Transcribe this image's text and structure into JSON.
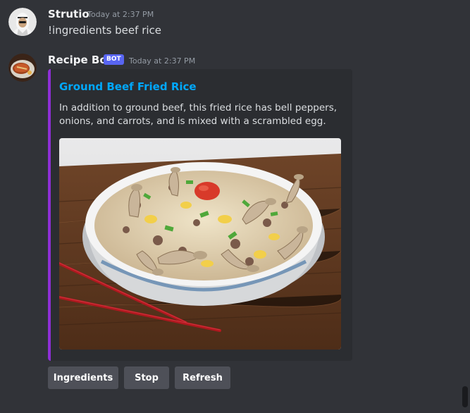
{
  "messages": [
    {
      "author": "Strutio",
      "timestamp": "Today at 2:37 PM",
      "text": "!ingredients beef rice"
    },
    {
      "author": "Recipe Bot",
      "badge": "BOT",
      "timestamp": "Today at 2:37 PM",
      "embed": {
        "title": "Ground Beef Fried Rice",
        "description": "In addition to ground beef, this fried rice has bell peppers, onions, and carrots, and is mixed with a scrambled egg.",
        "accent_color": "#8e2fd6"
      },
      "buttons": [
        {
          "label": "Ingredients"
        },
        {
          "label": "Stop"
        },
        {
          "label": "Refresh"
        }
      ]
    }
  ],
  "theme": {
    "background": "#313338",
    "embed_background": "#2b2d31",
    "link_color": "#00a8fc",
    "bot_badge_color": "#5865f2",
    "button_color": "#4e5058"
  }
}
